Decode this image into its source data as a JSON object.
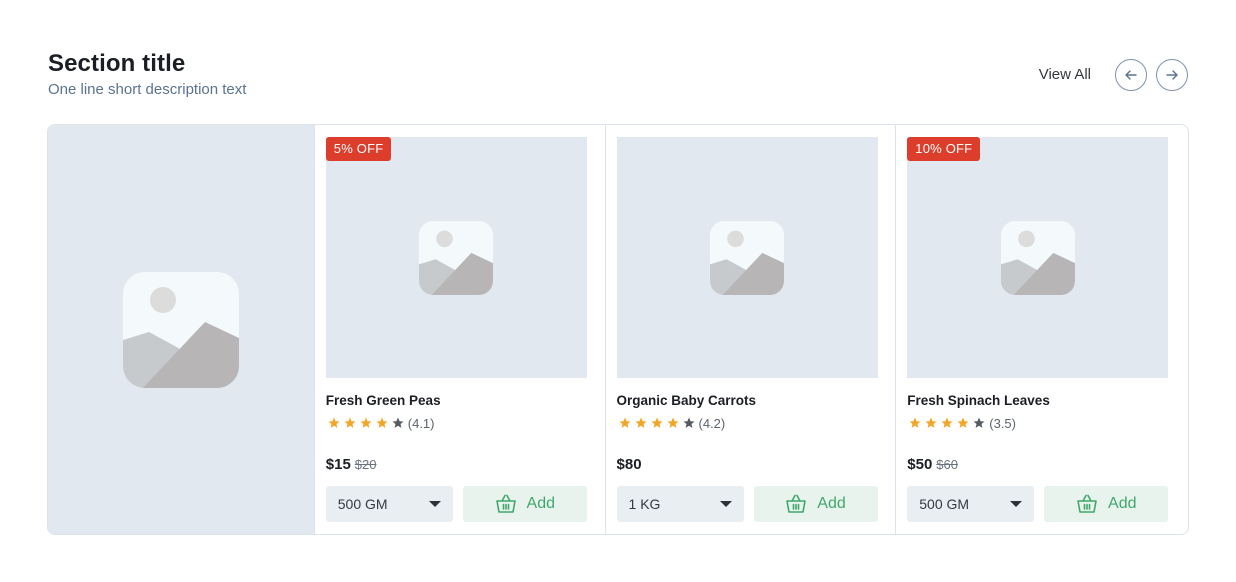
{
  "section": {
    "title": "Section title",
    "description": "One line short description text",
    "view_all": "View All"
  },
  "icons": {
    "prev": "arrow-left-icon",
    "next": "arrow-right-icon",
    "placeholder": "image-placeholder-icon",
    "star": "star-icon",
    "cart": "basket-icon",
    "dropdown": "chevron-down-icon"
  },
  "colors": {
    "badge": "#dd3d2b",
    "star_filled": "#f2a628",
    "star_empty": "#555b63",
    "add_text": "#41a86d",
    "add_bg": "#e7f3ec",
    "placeholder_bg": "#e1e8f0"
  },
  "products": [
    {
      "badge": "5% OFF",
      "name": "Fresh Green Peas",
      "rating": 4.1,
      "rating_text": "(4.1)",
      "stars_filled": 4,
      "price": "$15",
      "old_price": "$20",
      "quantity": "500 GM",
      "add_label": "Add"
    },
    {
      "badge": "",
      "name": "Organic Baby Carrots",
      "rating": 4.2,
      "rating_text": "(4.2)",
      "stars_filled": 4,
      "price": "$80",
      "old_price": "",
      "quantity": "1 KG",
      "add_label": "Add"
    },
    {
      "badge": "10% OFF",
      "name": "Fresh Spinach Leaves",
      "rating": 3.5,
      "rating_text": "(3.5)",
      "stars_filled": 4,
      "price": "$50",
      "old_price": "$60",
      "quantity": "500 GM",
      "add_label": "Add"
    }
  ]
}
